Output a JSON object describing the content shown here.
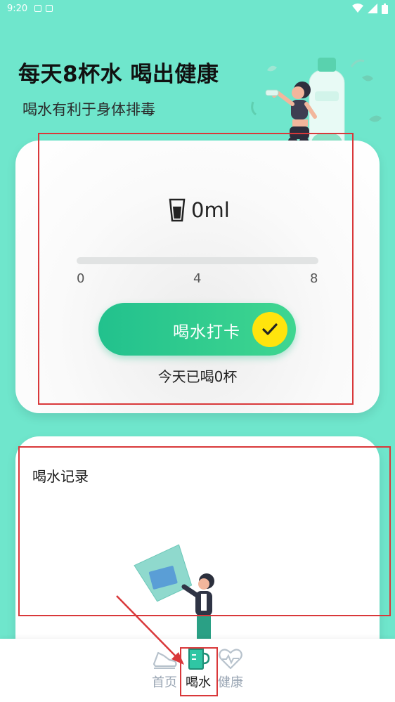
{
  "status_bar": {
    "time": "9:20"
  },
  "header": {
    "headline": "每天8杯水 喝出健康",
    "subline": "喝水有利于身体排毒"
  },
  "water_card": {
    "amount": "0ml",
    "progress_fraction": 0,
    "ticks": [
      "0",
      "4",
      "8"
    ],
    "checkin_label": "喝水打卡",
    "today_text": "今天已喝0杯"
  },
  "record_card": {
    "title": "喝水记录"
  },
  "bottom_nav": {
    "items": [
      {
        "label": "首页",
        "icon": "shoe-icon",
        "active": false
      },
      {
        "label": "喝水",
        "icon": "cup-icon",
        "active": true
      },
      {
        "label": "健康",
        "icon": "heart-pulse-icon",
        "active": false
      }
    ]
  },
  "colors": {
    "background": "#6fe6cc",
    "accent_green": "#22c18d",
    "check_yellow": "#ffe40d",
    "annotation_red": "#d9383a"
  }
}
